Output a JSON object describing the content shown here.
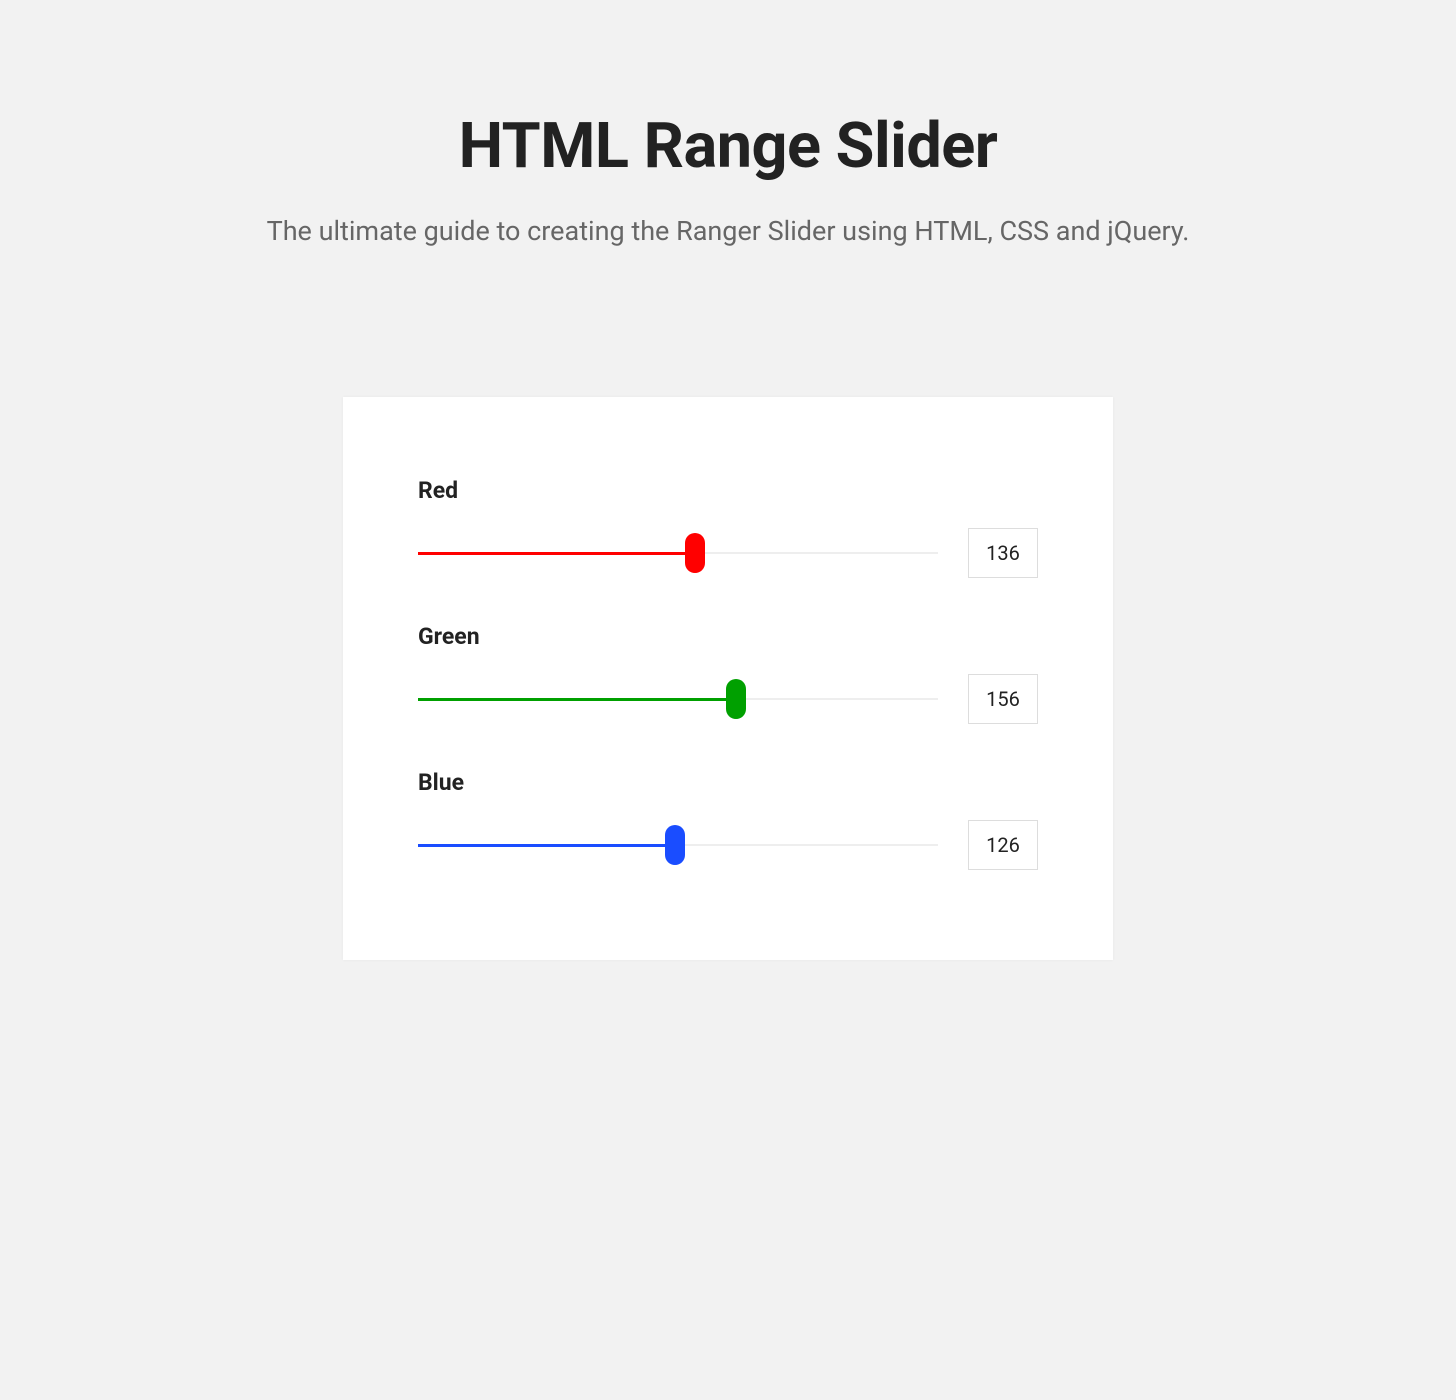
{
  "title": "HTML Range Slider",
  "subtitle": "The ultimate guide to creating the Ranger Slider using HTML, CSS and jQuery.",
  "sliders": {
    "max": 255,
    "red": {
      "label": "Red",
      "value": 136,
      "color": "#ff0000"
    },
    "green": {
      "label": "Green",
      "value": 156,
      "color": "#00a000"
    },
    "blue": {
      "label": "Blue",
      "value": 126,
      "color": "#1a4dff"
    }
  }
}
